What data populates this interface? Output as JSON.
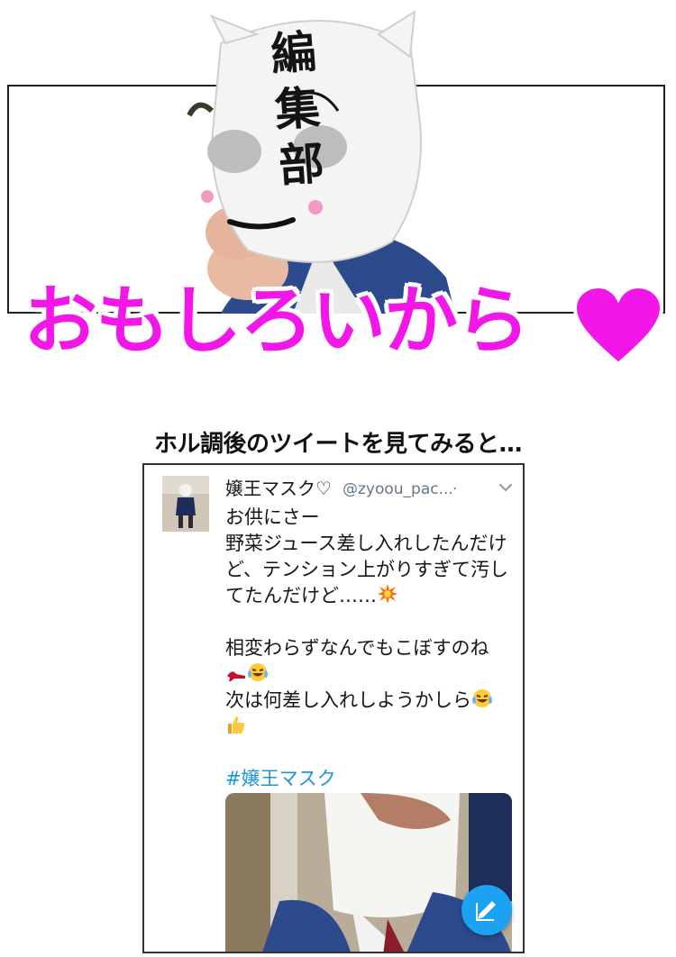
{
  "manga": {
    "mask_text": [
      "編",
      "集",
      "部"
    ],
    "headline": "おもしろいから",
    "headline_heart": "heart-icon",
    "accent_color": "#f316e8"
  },
  "caption": "ホル調後のツイートを見てみると…",
  "tweet": {
    "display_name": "嬢王マスク♡",
    "handle": "@zyoou_pac...",
    "dot": "·",
    "lines": [
      "お供にさー",
      "野菜ジュース差し入れしたんだけ",
      "ど、テンション上がりすぎて汚し",
      "てたんだけど……"
    ],
    "lines2": [
      "相変わらずなんでもこぼすのね"
    ],
    "line_next": "次は何差し入れしようかしら",
    "hashtag": "#嬢王マスク",
    "emojis": [
      "collision-emoji",
      "high-heel-emoji",
      "laughing-tears-emoji",
      "thumbs-up-emoji"
    ],
    "link_color": "#1b95e0",
    "compose_color": "#1da1f2"
  }
}
